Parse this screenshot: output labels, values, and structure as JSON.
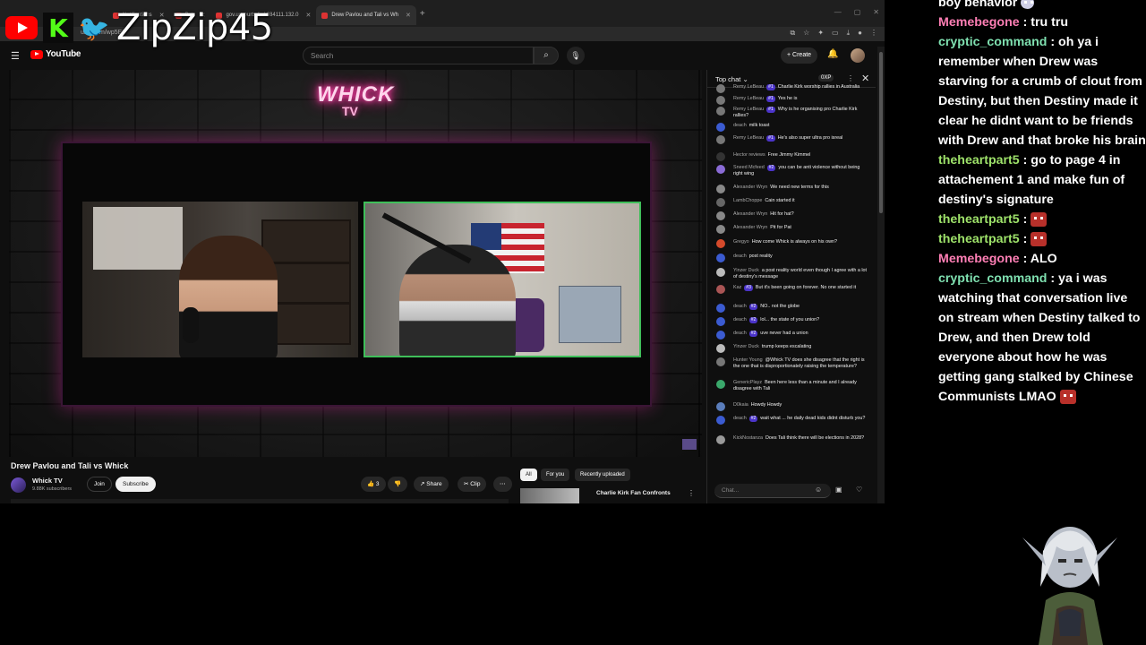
{
  "overlay": {
    "handle": "ZipZip45"
  },
  "browser": {
    "tabs": [
      {
        "label": "Notifications",
        "active": false
      },
      {
        "label": "Bot",
        "active": false
      },
      {
        "label": "gov.uscourts.fod.684111.132.0",
        "active": false
      },
      {
        "label": "Drew Pavlou and Tali vs Wh",
        "active": true
      }
    ],
    "url": "ube.com/wp5E2"
  },
  "youtube": {
    "brand": "YouTube",
    "search_placeholder": "Search",
    "create_label": "Create",
    "video_title": "Drew Pavlou and Tali vs Whick",
    "neon_sign": "WHICK",
    "neon_sub": "TV",
    "channel": {
      "name": "Whick TV",
      "subs": "9.88K subscribers",
      "join": "Join",
      "subscribe": "Subscribe"
    },
    "actions": {
      "likes": "3",
      "share": "Share",
      "clip": "Clip"
    },
    "chips": [
      "All",
      "For you",
      "Recently uploaded"
    ],
    "recommended": {
      "title": "Charlie Kirk Fan Confronts"
    },
    "chat": {
      "header": "Top chat",
      "xp": "0XP",
      "input_placeholder": "Chat...",
      "messages": [
        {
          "author": "Remy LeBeau",
          "badge": "#1",
          "text": "Charlie Kirk worship rallies in Australia",
          "color": "#777"
        },
        {
          "author": "Remy LeBeau",
          "badge": "#1",
          "text": "Yes he is",
          "color": "#777"
        },
        {
          "author": "Remy LeBeau",
          "badge": "#1",
          "text": "Why is he organising pro Charlie Kirk rallies?",
          "color": "#777"
        },
        {
          "author": "deach",
          "badge": "",
          "text": "milk toast",
          "color": "#3b5bd1"
        },
        {
          "author": "Remy LeBeau",
          "badge": "#1",
          "text": "He's also super ultra pro isreal",
          "color": "#777"
        },
        {
          "author": "Hector reviews",
          "badge": "",
          "text": "Free Jimmy Kimmel",
          "color": "#333"
        },
        {
          "author": "Sneed Mcfeed",
          "badge": "#2",
          "text": "you can be anti violence without being right wing",
          "color": "#8a6bd6"
        },
        {
          "author": "Alexander Wryn",
          "badge": "",
          "text": "We need new terms for this",
          "color": "#888"
        },
        {
          "author": "LambChoppe",
          "badge": "",
          "text": "Cain started it",
          "color": "#666"
        },
        {
          "author": "Alexander Wryn",
          "badge": "",
          "text": "Hit for hat?",
          "color": "#888"
        },
        {
          "author": "Alexander Wryn",
          "badge": "",
          "text": "Pit for Pat",
          "color": "#888"
        },
        {
          "author": "Gregyo",
          "badge": "",
          "text": "How come Whick is always on his own?",
          "color": "#d54a2b"
        },
        {
          "author": "deach",
          "badge": "",
          "text": "post reality",
          "color": "#3b5bd1"
        },
        {
          "author": "Yinzer Duck",
          "badge": "",
          "text": "a post reality world even though I agree with a lot of destiny's message",
          "color": "#bbb"
        },
        {
          "author": "Kaz",
          "badge": "#3",
          "text": "But it's been going on forever. No one started it",
          "color": "#a55"
        },
        {
          "author": "deach",
          "badge": "#2",
          "text": "NO.. not the globe",
          "color": "#3b5bd1"
        },
        {
          "author": "deach",
          "badge": "#2",
          "text": "lol... the state of you union?",
          "color": "#3b5bd1"
        },
        {
          "author": "deach",
          "badge": "#2",
          "text": "uve never had a union",
          "color": "#3b5bd1"
        },
        {
          "author": "Yinzer Duck",
          "badge": "",
          "text": "trump keeps escalating",
          "color": "#bbb"
        },
        {
          "author": "Hunter Young",
          "badge": "",
          "text": "@Whick TV does she disagree that the right is the one that is disproportionately raising the temperature?",
          "color": "#777"
        },
        {
          "author": "GenericPlayz",
          "badge": "",
          "text": "Been here less than a minute and I already disagree with Tali",
          "color": "#3aa86b"
        },
        {
          "author": "D0kaia",
          "badge": "",
          "text": "Howdy Howdy",
          "color": "#5a7dbb"
        },
        {
          "author": "deach",
          "badge": "#2",
          "text": "wait what ... he daily dead kids didnt disturb you?",
          "color": "#3b5bd1"
        },
        {
          "author": "KickNostanza",
          "badge": "",
          "text": "Does Tali think there will be elections in 2028?",
          "color": "#999"
        }
      ]
    }
  },
  "stream_chat": [
    {
      "name": "",
      "text": "boy behavior",
      "color": "#ffffff",
      "emote": "ghost"
    },
    {
      "name": "Memebegone",
      "text": ": tru tru",
      "color": "#ff7fb5",
      "emote": ""
    },
    {
      "name": "cryptic_command",
      "text": ": oh ya i remember when Drew was starving for a crumb of clout from Destiny, but then Destiny made it clear he didnt want to be friends with Drew and that broke his brain",
      "color": "#7fe0b0",
      "emote": ""
    },
    {
      "name": "theheartpart5",
      "text": ": go to page 4 in attachement 1 and make fun of destiny's signature",
      "color": "#9ee26a",
      "emote": ""
    },
    {
      "name": "theheartpart5",
      "text": ":",
      "color": "#9ee26a",
      "emote": "red"
    },
    {
      "name": "theheartpart5",
      "text": ":",
      "color": "#9ee26a",
      "emote": "red"
    },
    {
      "name": "Memebegone",
      "text": ": ALO",
      "color": "#ff7fb5",
      "emote": ""
    },
    {
      "name": "cryptic_command",
      "text": ": ya i was watching that conversation live on stream when Destiny talked to Drew, and then Drew told everyone about how he was getting gang stalked by Chinese Communists LMAO",
      "color": "#7fe0b0",
      "emote": "red"
    }
  ]
}
